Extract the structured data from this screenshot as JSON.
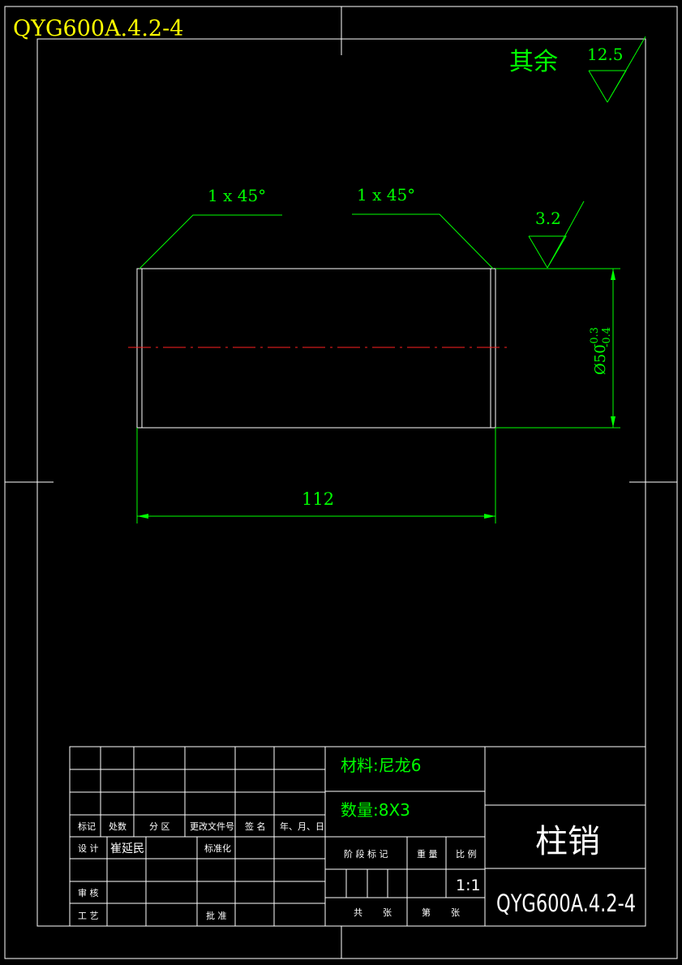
{
  "drawing": {
    "code_top": "QYG600A.4.2-4",
    "roughness_rest_label": "其余",
    "roughness_rest_value": "12.5",
    "chamfer_left": "1 x 45°",
    "chamfer_right": "1 x 45°",
    "roughness_surface": "3.2",
    "diameter_label": "Ø50",
    "tolerance_upper": "-0.3",
    "tolerance_lower": "-0.4",
    "length": "112"
  },
  "title_block": {
    "material": "材料:尼龙6",
    "quantity": "数量:8X3",
    "part_name": "柱销",
    "part_code": "QYG600A.4.2-4",
    "scale": "1:1",
    "headers": {
      "mark": "标记",
      "count": "处数",
      "zone": "分 区",
      "change_doc": "更改文件号",
      "signature": "签 名",
      "date": "年、月、日",
      "design": "设 计",
      "designer": "崔延民",
      "standardize": "标准化",
      "review": "审 核",
      "process": "工 艺",
      "approve": "批 准",
      "stage_mark": "阶 段 标 记",
      "weight": "重 量",
      "ratio": "比 例",
      "total": "共",
      "sheets1": "张",
      "nth": "第",
      "sheets2": "张"
    }
  }
}
